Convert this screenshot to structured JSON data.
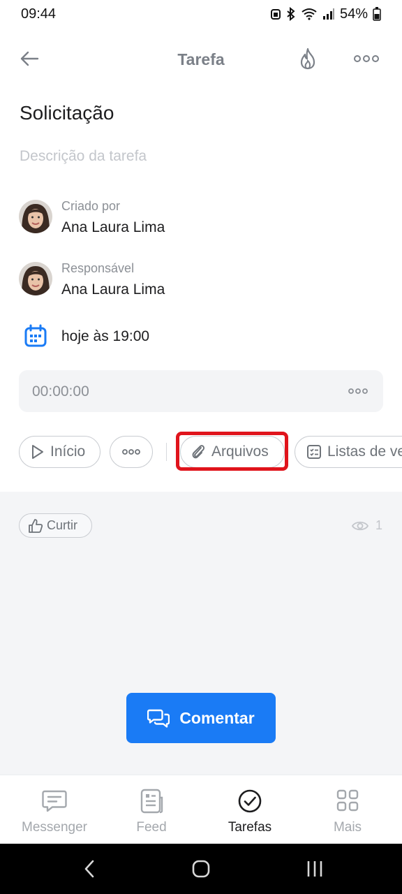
{
  "status": {
    "time": "09:44",
    "battery": "54%"
  },
  "header": {
    "title": "Tarefa",
    "back_icon": "arrow-left-icon",
    "fire_icon": "flame-icon",
    "more_icon": "more-dots-icon"
  },
  "task": {
    "title": "Solicitação",
    "description_placeholder": "Descrição da tarefa",
    "created_by_label": "Criado por",
    "created_by_name": "Ana Laura Lima",
    "responsible_label": "Responsável",
    "responsible_name": "Ana Laura Lima",
    "deadline": "hoje às 19:00",
    "timer": "00:00:00"
  },
  "actions": {
    "start_label": "Início",
    "files_label": "Arquivos",
    "lists_label": "Listas de ve"
  },
  "highlight_color": "#e0141c",
  "feedback": {
    "like_label": "Curtir",
    "views_count": "1"
  },
  "comment_button": "Comentar",
  "accent_color": "#1a7bf5",
  "tabs": [
    {
      "label": "Messenger",
      "icon": "chat-icon"
    },
    {
      "label": "Feed",
      "icon": "feed-icon"
    },
    {
      "label": "Tarefas",
      "icon": "check-circle-icon"
    },
    {
      "label": "Mais",
      "icon": "grid-icon"
    }
  ]
}
